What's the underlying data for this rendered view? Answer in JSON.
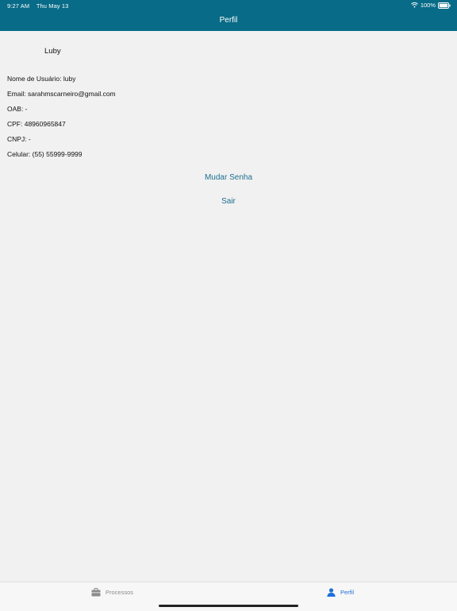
{
  "status_bar": {
    "time": "9:27 AM",
    "date": "Thu May 13",
    "battery": "100%"
  },
  "header": {
    "title": "Perfil"
  },
  "profile": {
    "name": "Luby",
    "fields": [
      "Nome de Usuário: luby",
      "Email: sarahmscarneiro@gmail.com",
      "OAB: -",
      "CPF: 48960965847",
      "CNPJ: -",
      "Celular: (55) 55999-9999"
    ]
  },
  "actions": {
    "change_password": "Mudar Senha",
    "logout": "Sair"
  },
  "tabbar": {
    "items": [
      {
        "label": "Processos",
        "icon": "briefcase-icon"
      },
      {
        "label": "Perfil",
        "icon": "person-icon"
      }
    ]
  },
  "colors": {
    "header": "#086b87",
    "link": "#1d6f92",
    "tab_active": "#1f6fdc",
    "background": "#f1f1f1"
  }
}
